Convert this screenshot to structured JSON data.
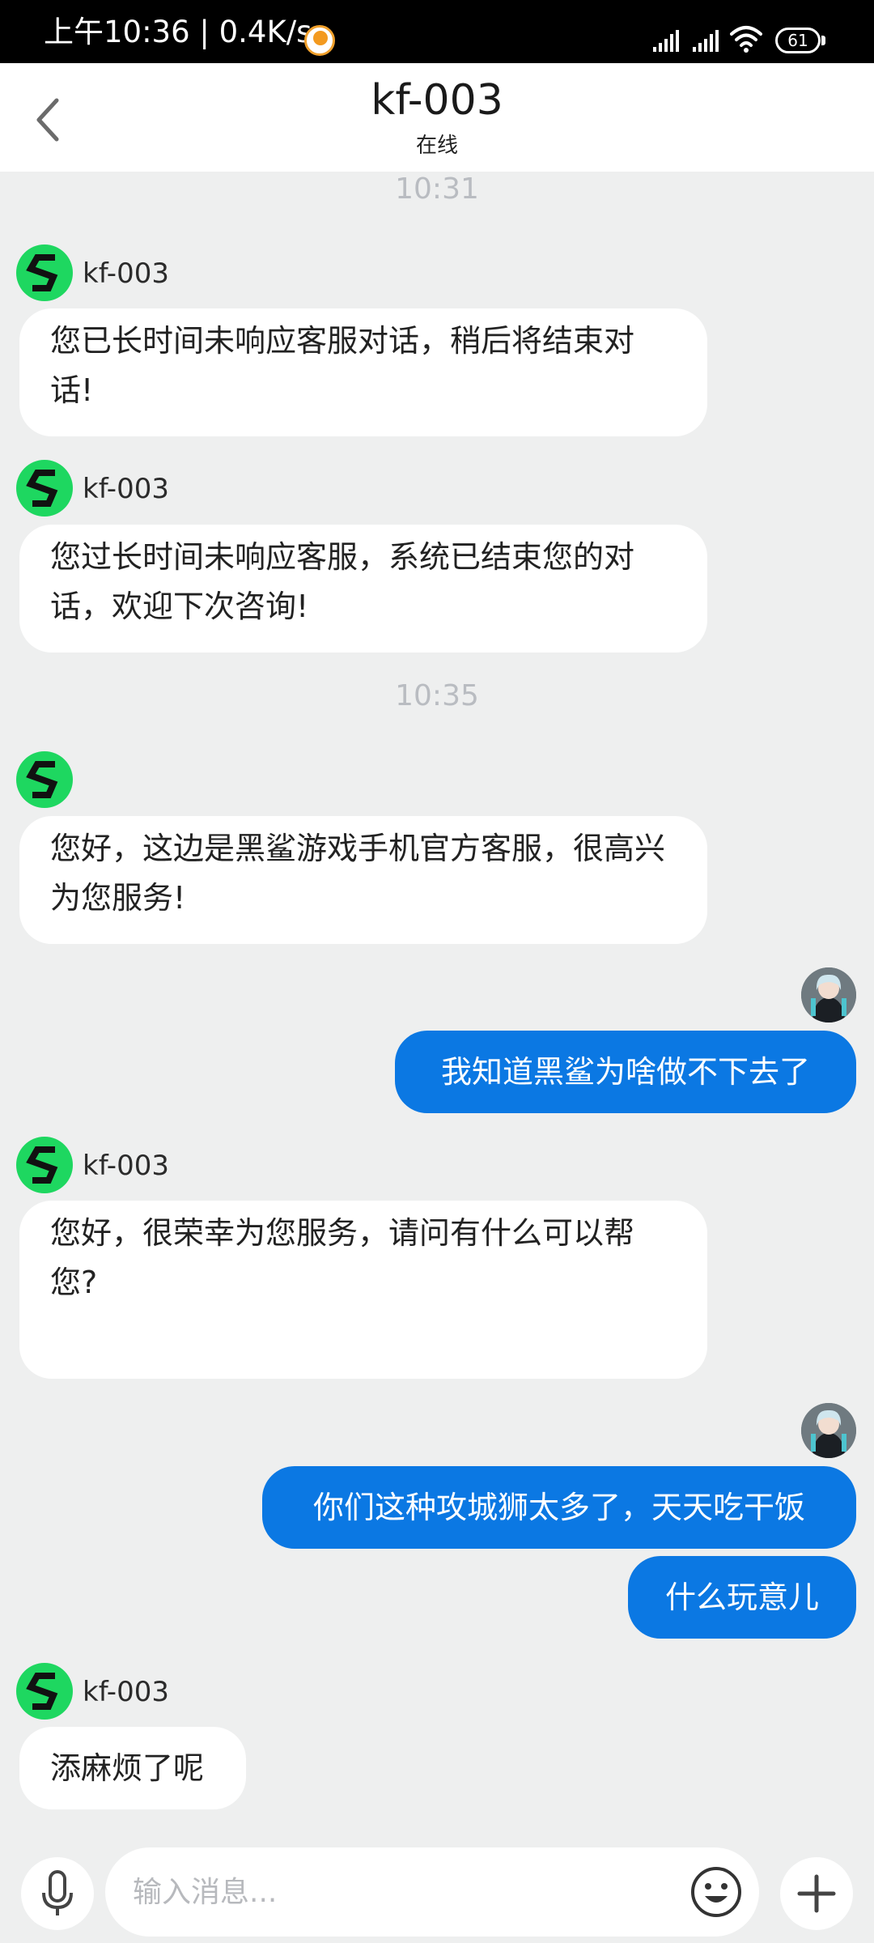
{
  "status_bar": {
    "time_speed": "上午10:36 | 0.4K/s",
    "battery": "61"
  },
  "header": {
    "title": "kf-003",
    "status": "在线"
  },
  "timestamps": [
    "10:31",
    "10:35"
  ],
  "agent_name": "kf-003",
  "messages": [
    {
      "from": "agent",
      "name": "kf-003",
      "text": "您已长时间未响应客服对话，稍后将结束对话!"
    },
    {
      "from": "agent",
      "name": "kf-003",
      "text": "您过长时间未响应客服，系统已结束您的对话，欢迎下次咨询!"
    },
    {
      "from": "agent",
      "name": "",
      "text": "您好，这边是黑鲨游戏手机官方客服，很高兴为您服务!"
    },
    {
      "from": "user",
      "text": "我知道黑鲨为啥做不下去了"
    },
    {
      "from": "agent",
      "name": "kf-003",
      "text": "您好，很荣幸为您服务，请问有什么可以帮您?"
    },
    {
      "from": "user",
      "text": "你们这种攻城狮太多了，天天吃干饭"
    },
    {
      "from": "user",
      "text": "什么玩意儿"
    },
    {
      "from": "agent",
      "name": "kf-003",
      "text": "添麻烦了呢"
    }
  ],
  "input": {
    "placeholder": "输入消息..."
  },
  "icons": {
    "back": "chevron-left-icon",
    "voice": "microphone-icon",
    "emoji": "smiley-icon",
    "plus": "plus-icon",
    "agent_avatar": "blackshark-logo-icon"
  },
  "colors": {
    "user_bubble": "#0b78e3",
    "agent_avatar": "#1ed760",
    "background": "#eeefef"
  }
}
